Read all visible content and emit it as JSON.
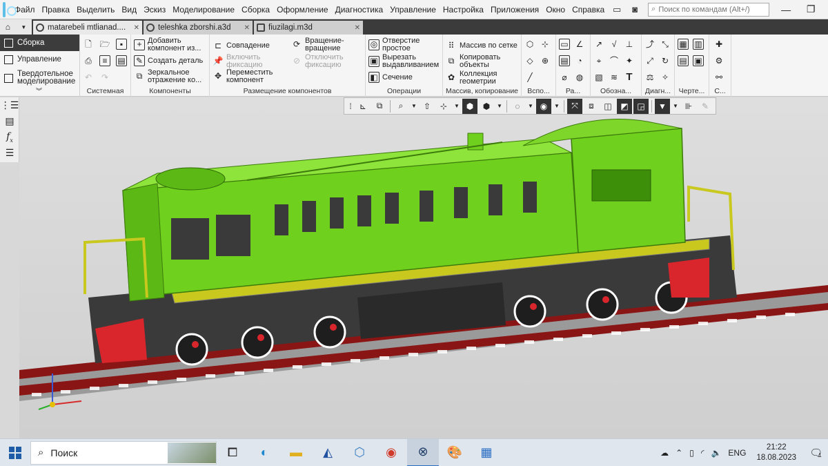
{
  "menu": {
    "items": [
      "Файл",
      "Правка",
      "Выделить",
      "Вид",
      "Эскиз",
      "Моделирование",
      "Сборка",
      "Оформление",
      "Диагностика",
      "Управление",
      "Настройка",
      "Приложения",
      "Окно",
      "Справка"
    ],
    "search_placeholder": "Поиск по командам (Alt+/)"
  },
  "tabs": [
    {
      "label": "matarebeli mtlianad....",
      "active": true
    },
    {
      "label": "teleshka zborshi.a3d",
      "active": false
    },
    {
      "label": "fiuzilagi.m3d",
      "active": false
    }
  ],
  "modes": {
    "assembly": "Сборка",
    "manage": "Управление",
    "solid": "Твердотельное моделирование"
  },
  "ribbon": {
    "system_label": "Системная",
    "components": {
      "add": "Добавить компонент из...",
      "create": "Создать деталь",
      "mirror": "Зеркальное отражение ко...",
      "label": "Компоненты"
    },
    "placement": {
      "match": "Совпадение",
      "enable_fix": "Включить фиксацию",
      "move": "Переместить компонент",
      "rotate": "Вращение-вращение",
      "disable_fix": "Отключить фиксацию",
      "label": "Размещение компонентов"
    },
    "operations": {
      "hole": "Отверстие простое",
      "extrude_cut": "Вырезать выдавливанием",
      "section": "Сечение",
      "label": "Операции"
    },
    "array": {
      "grid": "Массив по сетке",
      "copy": "Копировать объекты",
      "collection": "Коллекция геометрии",
      "label": "Массив, копирование"
    },
    "small_labels": {
      "aux": "Вспо...",
      "sizes": "Ра...",
      "designations": "Обозна...",
      "diagrams": "Диагн...",
      "drawing": "Черте...",
      "other": "С..."
    }
  },
  "taskbar": {
    "search": "Поиск",
    "lang": "ENG",
    "time": "21:22",
    "date": "18.08.2023",
    "notifications": "1"
  },
  "colors": {
    "body_green": "#6fd01e",
    "frame_yellow": "#c9c81e",
    "rail_red": "#8a1515",
    "accent_red": "#d8262c"
  }
}
